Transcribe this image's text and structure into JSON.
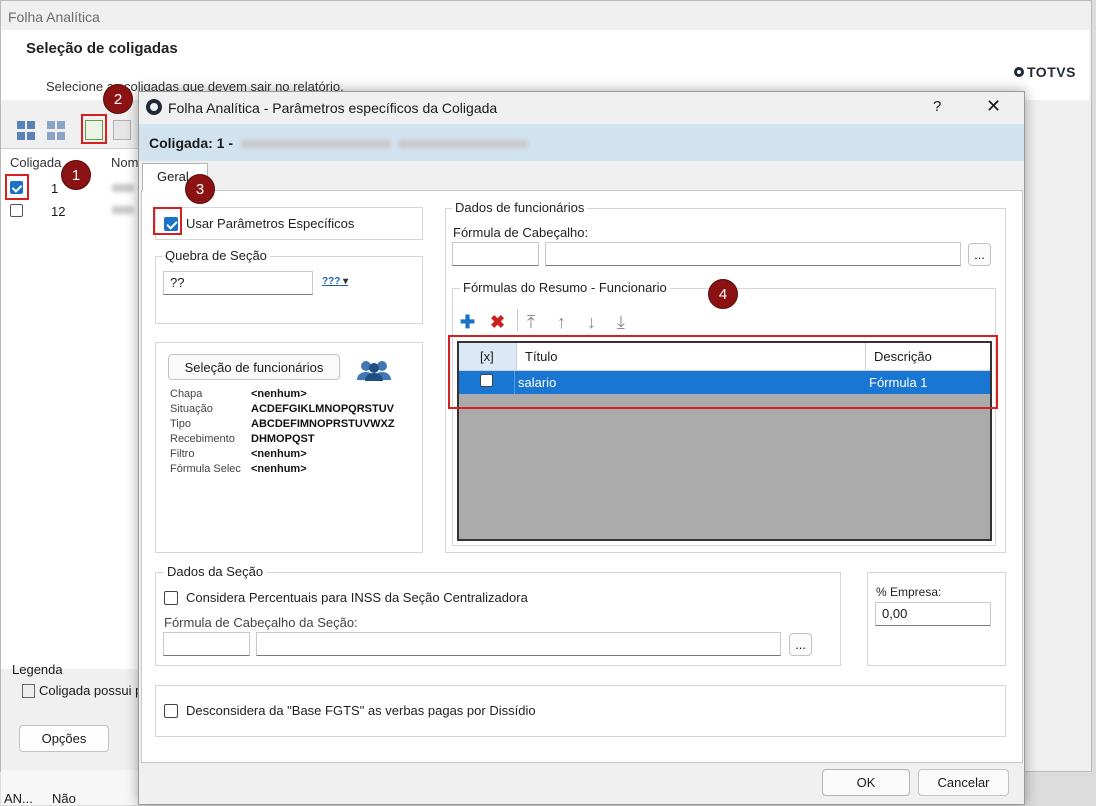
{
  "background_window": {
    "title": "Folha Analítica",
    "heading": "Seleção de coligadas",
    "subtitle": "Selecione as coligadas que devem sair no relatório.",
    "brand": "TOTVS",
    "columns": [
      "Coligada",
      "Nom"
    ],
    "rows": [
      {
        "checked": true,
        "coligada": "1"
      },
      {
        "checked": false,
        "coligada": "12"
      }
    ],
    "legend_title": "Legenda",
    "legend_item": "Coligada possui p",
    "options_button": "Opções",
    "bottom_cells": [
      "AN...",
      "Não"
    ]
  },
  "dialog": {
    "title": "Folha Analítica - Parâmetros específicos da Coligada",
    "help": "?",
    "close": "✕",
    "coligada_label": "Coligada: 1 -",
    "tab": "Geral",
    "usar_parametros": {
      "label": "Usar Parâmetros Específicos",
      "checked": true
    },
    "quebra_secao": {
      "label": "Quebra de Seção",
      "value": "??",
      "dropdown_icon": "???"
    },
    "selecao_funcionarios": {
      "button": "Seleção de funcionários",
      "items": [
        {
          "k": "Chapa",
          "v": "<nenhum>"
        },
        {
          "k": "Situação",
          "v": "ACDEFGIKLMNOPQRSTUV"
        },
        {
          "k": "Tipo",
          "v": "ABCDEFIMNOPRSTUVWXZ"
        },
        {
          "k": "Recebimento",
          "v": "DHMOPQST"
        },
        {
          "k": "Filtro",
          "v": "<nenhum>"
        },
        {
          "k": "Fórmula Selec",
          "v": "<nenhum>"
        }
      ]
    },
    "dados_funcionarios": {
      "label": "Dados de funcionários",
      "formula_cabecalho_label": "Fórmula de Cabeçalho:",
      "ellipsis": "..."
    },
    "formulas_resumo": {
      "label": "Fórmulas do Resumo - Funcionario",
      "columns": [
        "[x]",
        "Título",
        "Descrição"
      ],
      "rows": [
        {
          "checked": false,
          "titulo": "salario",
          "descricao": "Fórmula 1"
        }
      ]
    },
    "dados_secao": {
      "label": "Dados da Seção",
      "considera_label": "Considera Percentuais para INSS da Seção Centralizadora",
      "considera_checked": false,
      "formula_label": "Fórmula de Cabeçalho da Seção:",
      "ellipsis": "..."
    },
    "empresa": {
      "label": "% Empresa:",
      "value": "0,00"
    },
    "desconsidera": {
      "label": "Desconsidera da \"Base FGTS\" as verbas pagas por Dissídio",
      "checked": false
    },
    "ok": "OK",
    "cancel": "Cancelar"
  },
  "annotations": [
    "1",
    "2",
    "3",
    "4"
  ],
  "colors": {
    "selection": "#1976d2",
    "annotation": "#8b1212",
    "highlight_box": "#d62020",
    "header_band": "#d2e3f0"
  }
}
